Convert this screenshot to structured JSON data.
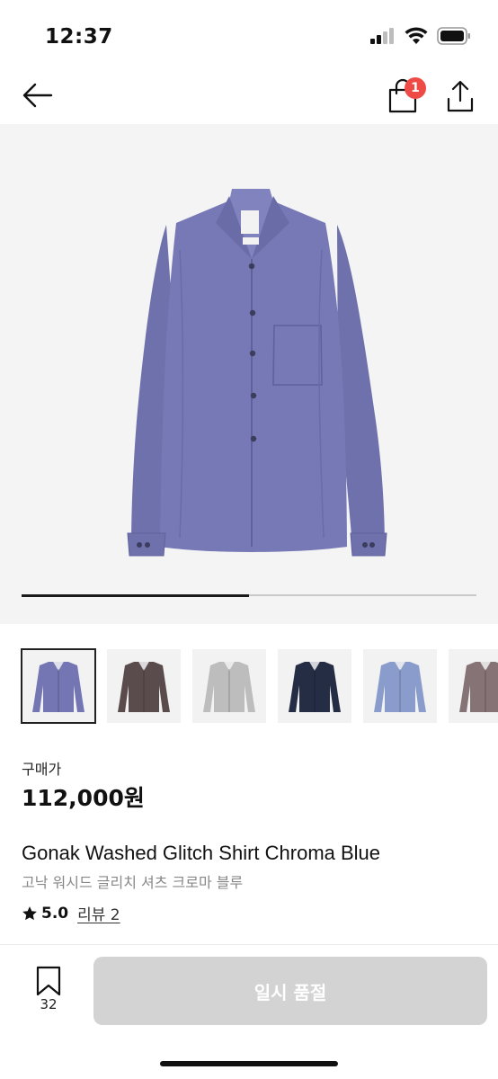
{
  "status_bar": {
    "time": "12:37"
  },
  "nav": {
    "cart_badge": "1"
  },
  "gallery": {
    "progress": 0.5
  },
  "thumbnails": [
    {
      "name": "thumb-chroma-blue",
      "color": "#7476b4",
      "active": true
    },
    {
      "name": "thumb-dark-brown",
      "color": "#5a4c4d",
      "active": false
    },
    {
      "name": "thumb-light-grey",
      "color": "#bdbdbd",
      "active": false
    },
    {
      "name": "thumb-navy",
      "color": "#252d44",
      "active": false
    },
    {
      "name": "thumb-light-blue",
      "color": "#8a9ccb",
      "active": false
    },
    {
      "name": "thumb-taupe",
      "color": "#857376",
      "active": false
    }
  ],
  "product": {
    "price_label": "구매가",
    "price": "112,000원",
    "title": "Gonak Washed Glitch Shirt Chroma Blue",
    "title_ko": "고낙 워시드 글리치 셔츠 크로마 블루",
    "rating": "5.0",
    "reviews_label": "리뷰 2"
  },
  "footer": {
    "bookmark_count": "32",
    "buy_label": "일시 품절"
  },
  "colors": {
    "shirt": "#7779b6",
    "badge": "#ef4b46",
    "disabled_button": "#d3d3d3"
  }
}
